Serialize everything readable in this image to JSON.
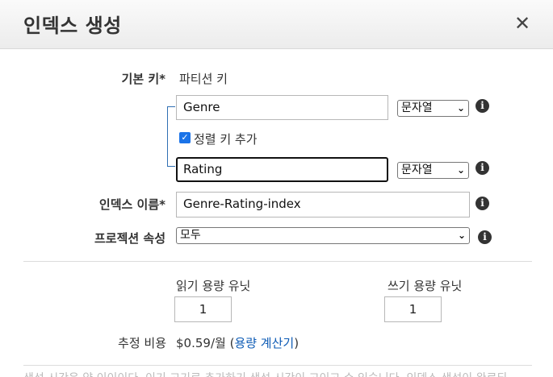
{
  "header": {
    "title": "인덱스 생성",
    "close_glyph": "✕"
  },
  "primary_key": {
    "label": "기본 키*",
    "partition_label": "파티션 키",
    "partition_value": "Genre",
    "partition_type": "문자열",
    "sort_checkbox_label": "정렬 키 추가",
    "sort_checked": true,
    "sort_value": "Rating",
    "sort_type": "문자열"
  },
  "index_name": {
    "label": "인덱스 이름*",
    "value": "Genre-Rating-index"
  },
  "projection": {
    "label": "프로젝션 속성",
    "value": "모두"
  },
  "capacity": {
    "read_label": "읽기 용량 유닛",
    "read_value": "1",
    "write_label": "쓰기 용량 유닛",
    "write_value": "1"
  },
  "cost": {
    "label": "추정 비용",
    "amount": "$0.59/월",
    "open_paren": "(",
    "calculator_link": "용량 계산기",
    "close_paren": ")"
  },
  "footer_note": "생성 시간은 약 이이이다. 이기 고기로 추가하기 생성 시간이 고이고 수 있습니다. 인덱스 생성이 완료되",
  "icons": {
    "info": "info-icon",
    "chevron": "chevron-down-icon",
    "close": "close-icon",
    "check": "checkbox-checked-icon"
  },
  "colors": {
    "link": "#0d5bb5",
    "checkbox": "#1a73e8",
    "bracket": "#2f6fb3"
  }
}
